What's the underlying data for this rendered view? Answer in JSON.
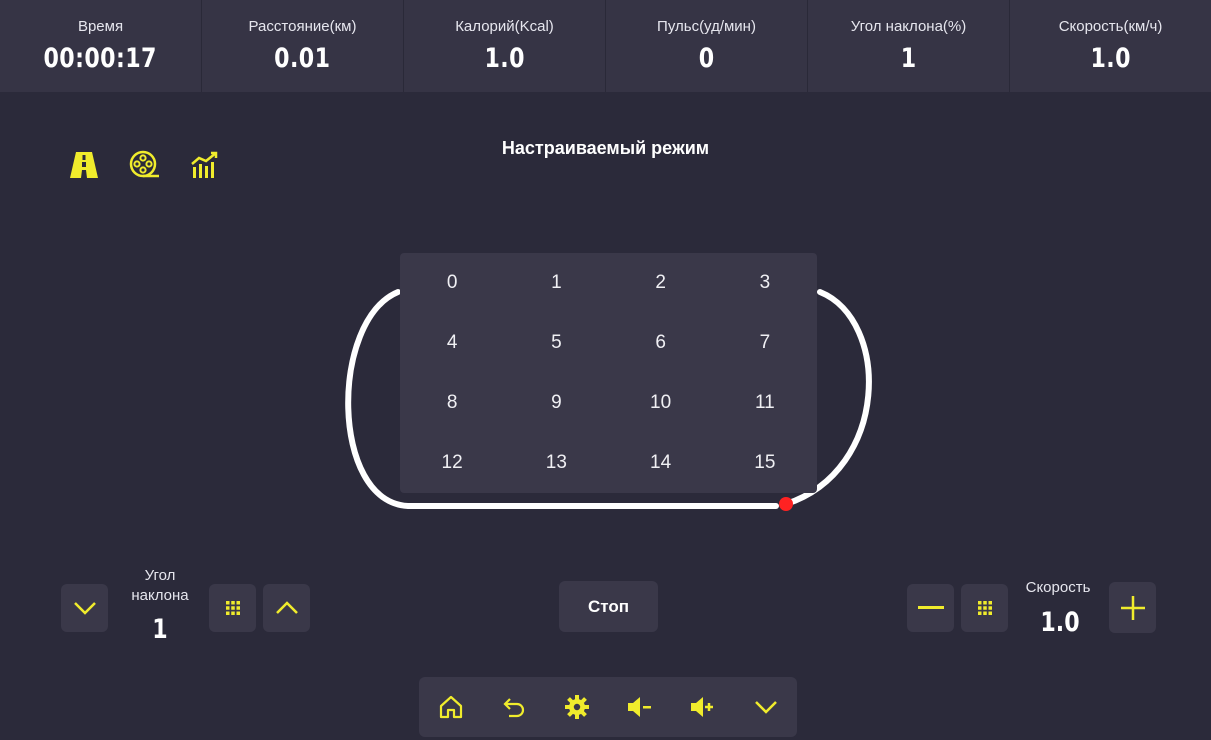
{
  "colors": {
    "accent": "#f0ec2c",
    "background": "#2b2a3a",
    "panel": "#363445",
    "tile": "#3a3849",
    "track": "#ffffff",
    "position_marker": "#ff2222"
  },
  "stats": [
    {
      "label": "Время",
      "value": "00:00:17"
    },
    {
      "label": "Расстояние(км)",
      "value": "0.01"
    },
    {
      "label": "Калорий(Kcal)",
      "value": "1.0"
    },
    {
      "label": "Пульс(уд/мин)",
      "value": "0"
    },
    {
      "label": "Угол наклона(%)",
      "value": "1"
    },
    {
      "label": "Скорость(км/ч)",
      "value": "1.0"
    }
  ],
  "mode_icons": [
    "road-icon",
    "film-reel-icon",
    "chart-icon"
  ],
  "mode_title": "Настраиваемый режим",
  "program_grid": [
    "0",
    "1",
    "2",
    "3",
    "4",
    "5",
    "6",
    "7",
    "8",
    "9",
    "10",
    "11",
    "12",
    "13",
    "14",
    "15"
  ],
  "incline": {
    "label_line1": "Угол",
    "label_line2": "наклона",
    "value": "1"
  },
  "speed": {
    "label": "Скорость",
    "value": "1.0"
  },
  "stop_label": "Стоп",
  "bottom_icons": [
    "home-icon",
    "back-icon",
    "settings-icon",
    "volume-down-icon",
    "volume-up-icon",
    "collapse-icon"
  ]
}
